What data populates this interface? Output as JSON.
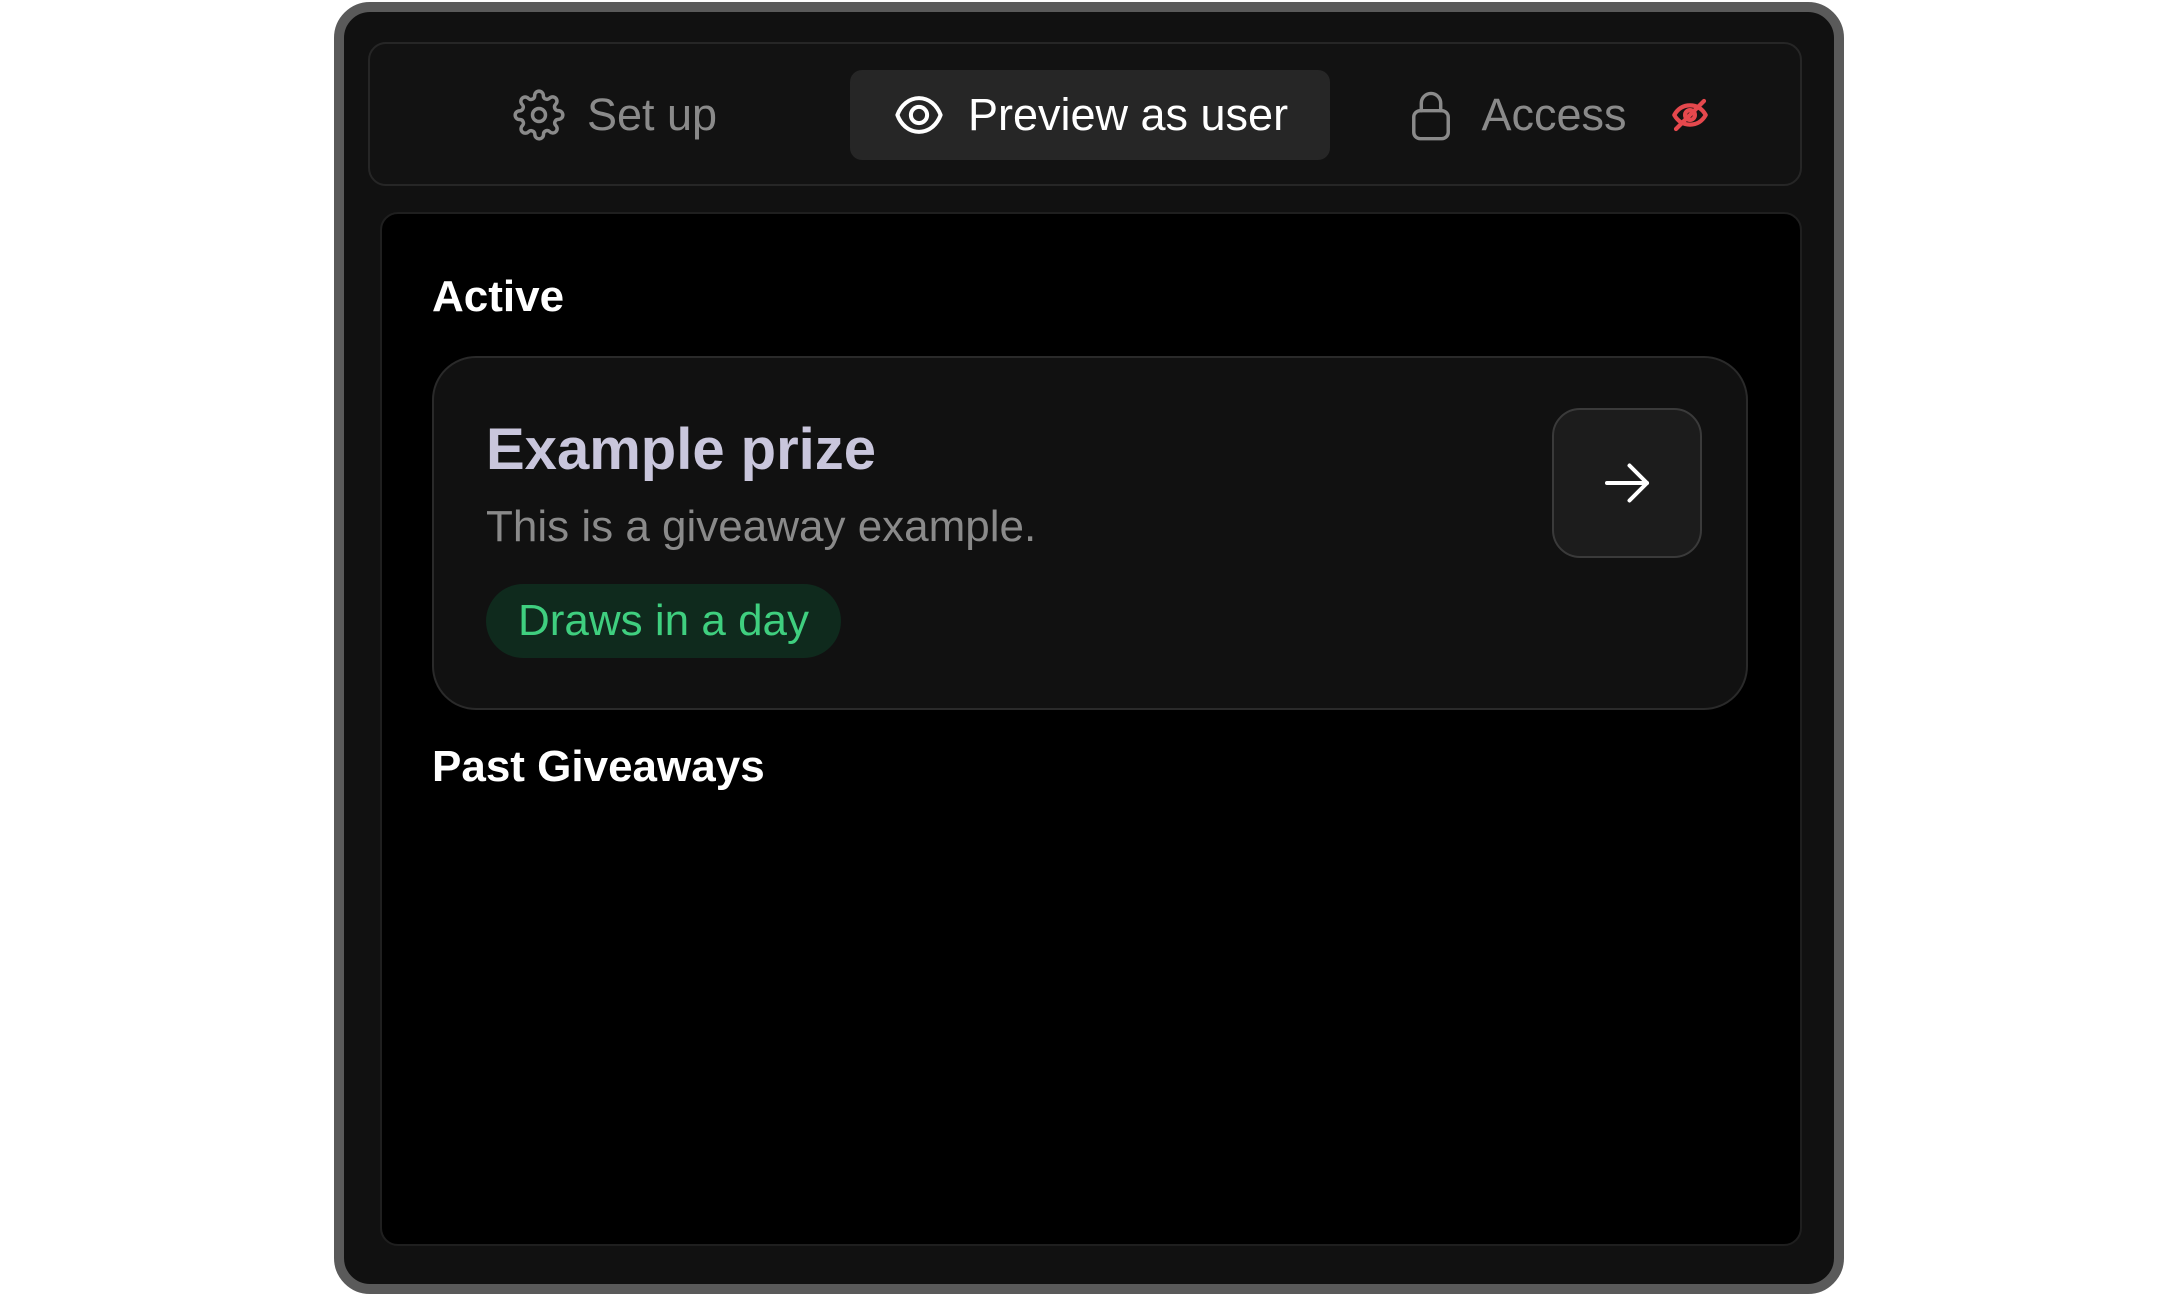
{
  "tabs": {
    "setup": {
      "label": "Set up",
      "icon": "gear-icon"
    },
    "preview": {
      "label": "Preview as user",
      "icon": "eye-icon"
    },
    "access": {
      "label": "Access",
      "icon": "lock-icon",
      "status_icon": "eye-off-icon"
    }
  },
  "sections": {
    "active": {
      "title": "Active"
    },
    "past": {
      "title": "Past Giveaways"
    }
  },
  "giveaway": {
    "title": "Example prize",
    "description": "This is a giveaway example.",
    "badge": "Draws in a day",
    "action_icon": "arrow-right-icon"
  },
  "colors": {
    "active_tab_bg": "#262626",
    "badge_text": "#3fcf7f",
    "badge_bg": "#0f2a1d",
    "hidden_icon": "#e5484d",
    "title_text": "#c9c6dc"
  }
}
